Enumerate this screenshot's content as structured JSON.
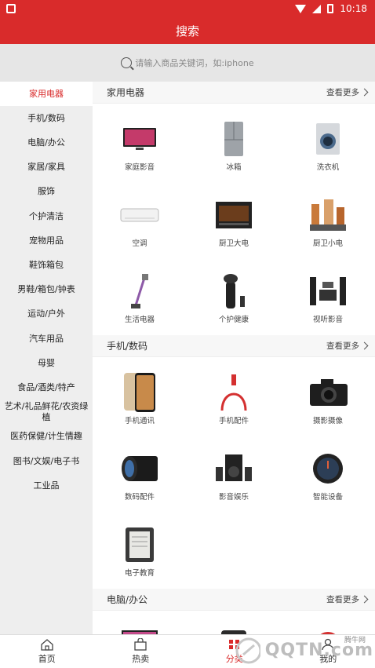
{
  "status": {
    "time": "10:18"
  },
  "header": {
    "title": "搜索"
  },
  "search": {
    "placeholder": "请输入商品关键词，如:iphone"
  },
  "sidebar": {
    "items": [
      {
        "label": "家用电器",
        "active": true
      },
      {
        "label": "手机/数码"
      },
      {
        "label": "电脑/办公"
      },
      {
        "label": "家居/家具"
      },
      {
        "label": "服饰"
      },
      {
        "label": "个护清洁"
      },
      {
        "label": "宠物用品"
      },
      {
        "label": "鞋饰箱包"
      },
      {
        "label": "男鞋/箱包/钟表"
      },
      {
        "label": "运动/户外"
      },
      {
        "label": "汽车用品"
      },
      {
        "label": "母婴"
      },
      {
        "label": "食品/酒类/特产"
      },
      {
        "label": "艺术/礼品鲜花/农资绿植"
      },
      {
        "label": "医药保健/计生情趣"
      },
      {
        "label": "图书/文娱/电子书"
      },
      {
        "label": "工业品"
      }
    ]
  },
  "sections": [
    {
      "title": "家用电器",
      "more": "查看更多",
      "items": [
        {
          "label": "家庭影音",
          "icon": "tv-icon"
        },
        {
          "label": "冰箱",
          "icon": "fridge-icon"
        },
        {
          "label": "洗衣机",
          "icon": "washer-icon"
        },
        {
          "label": "空调",
          "icon": "ac-icon"
        },
        {
          "label": "厨卫大电",
          "icon": "oven-icon"
        },
        {
          "label": "厨卫小电",
          "icon": "blender-icon"
        },
        {
          "label": "生活电器",
          "icon": "vacuum-icon"
        },
        {
          "label": "个护健康",
          "icon": "shaver-icon"
        },
        {
          "label": "视听影音",
          "icon": "speaker-set-icon"
        }
      ]
    },
    {
      "title": "手机/数码",
      "more": "查看更多",
      "items": [
        {
          "label": "手机通讯",
          "icon": "phone-icon"
        },
        {
          "label": "手机配件",
          "icon": "cable-icon"
        },
        {
          "label": "摄影摄像",
          "icon": "camera-icon"
        },
        {
          "label": "数码配件",
          "icon": "lens-icon"
        },
        {
          "label": "影音娱乐",
          "icon": "subwoofer-icon"
        },
        {
          "label": "智能设备",
          "icon": "watch-icon"
        },
        {
          "label": "电子教育",
          "icon": "ereader-icon"
        }
      ]
    },
    {
      "title": "电脑/办公",
      "more": "查看更多"
    }
  ],
  "tabs": [
    {
      "label": "首页",
      "icon": "home-icon"
    },
    {
      "label": "热卖",
      "icon": "bag-icon"
    },
    {
      "label": "分类",
      "icon": "category-icon",
      "active": true
    },
    {
      "label": "我的",
      "icon": "user-icon"
    }
  ],
  "watermark": {
    "text": "QQTN.com",
    "small": "腾牛网"
  },
  "colors": {
    "brand": "#d92b2b"
  }
}
